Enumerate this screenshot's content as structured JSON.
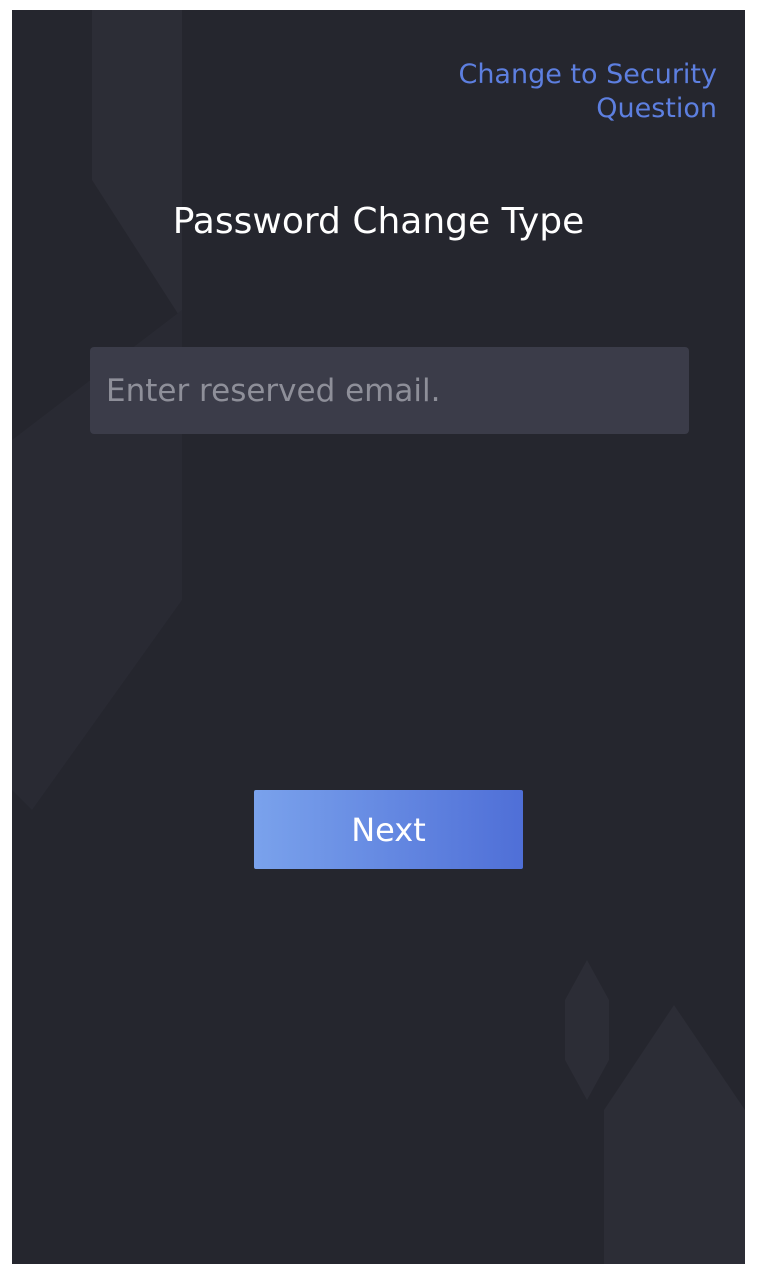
{
  "header": {
    "switch_link_line1": "Change to Security",
    "switch_link_line2": "Question"
  },
  "main": {
    "title": "Password Change Type",
    "email_input": {
      "value": "",
      "placeholder": "Enter reserved email."
    },
    "next_label": "Next"
  },
  "colors": {
    "background": "#25262e",
    "input_background": "#3b3c49",
    "link": "#5d7fe0",
    "button_gradient_start": "#7aa2ec",
    "button_gradient_end": "#4f6fd7"
  }
}
